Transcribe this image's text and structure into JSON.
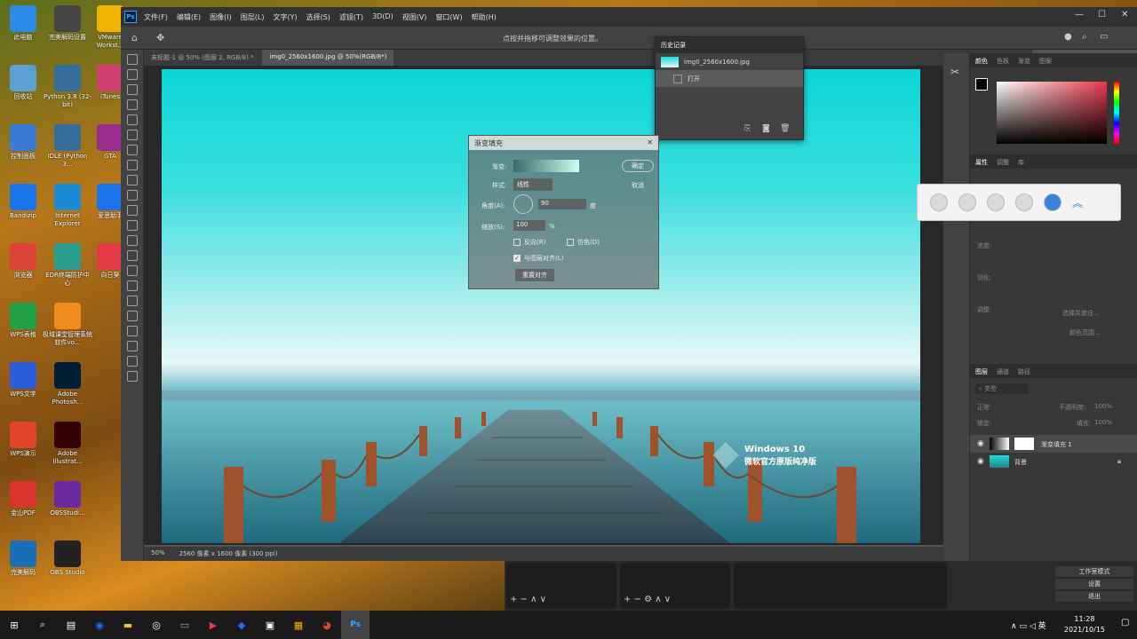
{
  "desktop": {
    "icons": [
      {
        "label": "此电脑",
        "color": "#2b8be6"
      },
      {
        "label": "完美解码设置",
        "color": "#444"
      },
      {
        "label": "VMware Workst...",
        "color": "#f0b400"
      },
      {
        "label": "回收站",
        "color": "#5aa0d0"
      },
      {
        "label": "Python 3.8 (32-bit)",
        "color": "#356d9b"
      },
      {
        "label": "iTunes",
        "color": "#d04070"
      },
      {
        "label": "控制面板",
        "color": "#3a7bd5"
      },
      {
        "label": "IDLE (Python 3...",
        "color": "#356d9b"
      },
      {
        "label": "GTA",
        "color": "#9b2b8b"
      },
      {
        "label": "Bandizip",
        "color": "#1a73e8"
      },
      {
        "label": "Internet Explorer",
        "color": "#1a8bd4"
      },
      {
        "label": "爱思助手",
        "color": "#1a73e8"
      },
      {
        "label": "浏览器",
        "color": "#db4437"
      },
      {
        "label": "EDR终端防护中心",
        "color": "#2a9d8f"
      },
      {
        "label": "向日葵",
        "color": "#e63946"
      },
      {
        "label": "WPS表格",
        "color": "#22a047"
      },
      {
        "label": "极域课堂管理系统软件vo...",
        "color": "#f08c1e"
      },
      {
        "label": "WPS文字",
        "color": "#2b5fd9"
      },
      {
        "label": "Adobe Photosh...",
        "color": "#001e36"
      },
      {
        "label": "WPS演示",
        "color": "#e0452b"
      },
      {
        "label": "Adobe Illustrat...",
        "color": "#330000"
      },
      {
        "label": "金山PDF",
        "color": "#d9342b"
      },
      {
        "label": "OBSStudi...",
        "color": "#6a2a9b"
      },
      {
        "label": "完美解码",
        "color": "#1a6fb8"
      },
      {
        "label": "OBS Studio",
        "color": "#222"
      }
    ]
  },
  "ps": {
    "logo": "Ps",
    "menu": [
      "文件(F)",
      "编辑(E)",
      "图像(I)",
      "图层(L)",
      "文字(Y)",
      "选择(S)",
      "滤镜(T)",
      "3D(D)",
      "视图(V)",
      "窗口(W)",
      "帮助(H)"
    ],
    "hint": "点按并拖移可调整效果的位置。",
    "tabs": [
      "未标题-1 @ 50% (图层 2, RGB/8) *",
      "img0_2560x1600.jpg @ 50%(RGB/8*)"
    ],
    "status": {
      "zoom": "50%",
      "info": "2560 像素 x 1600 像素 (300 ppi)"
    },
    "watermark": {
      "line1": "Windows 10",
      "line2": "微软官方原版纯净版"
    }
  },
  "history": {
    "title": "历史记录",
    "snapshot": "img0_2560x1600.jpg",
    "items": [
      "打开"
    ]
  },
  "dialog": {
    "title": "渐变填充",
    "gradient_label": "渐变:",
    "style_label": "样式:",
    "style_value": "线性",
    "angle_label": "角度(A):",
    "angle_value": "90",
    "angle_unit": "度",
    "scale_label": "缩放(S):",
    "scale_value": "100",
    "scale_unit": "%",
    "reverse": "反向(R)",
    "dither": "仿色(D)",
    "align": "与图层对齐(L)",
    "reset": "重置对齐",
    "ok": "确定",
    "cancel": "取消"
  },
  "panels": {
    "color_tabs": [
      "颜色",
      "色板",
      "渐变",
      "图案"
    ],
    "props_tabs": [
      "属性",
      "调整",
      "库"
    ],
    "props_rows": [
      "浓度:",
      "羽化:",
      "调整:"
    ],
    "props_buttons": [
      "选择并遮住...",
      "颜色范围..."
    ],
    "layers_tabs": [
      "图层",
      "通道",
      "路径"
    ],
    "layers_search": "类型",
    "blend_mode": "正常",
    "opacity_label": "不透明度:",
    "opacity_value": "100%",
    "lock_label": "锁定:",
    "fill_label": "填充:",
    "fill_value": "100%",
    "layers": [
      "渐变填充 1",
      "背景"
    ]
  },
  "obs": {
    "right_items": [
      "工作室模式",
      "设置",
      "退出"
    ]
  },
  "taskbar": {
    "time": "11:28",
    "date": "2021/10/15"
  }
}
